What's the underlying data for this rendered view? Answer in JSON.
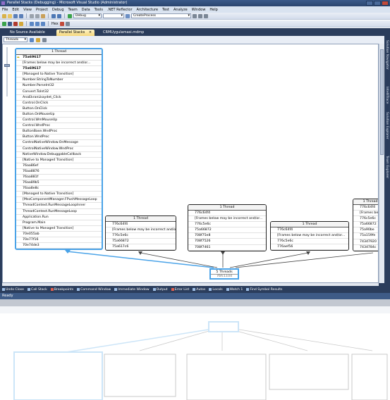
{
  "window": {
    "title": "Parallel Stacks (Debugging) - Microsoft Visual Studio (Administrator)"
  },
  "menu": [
    "File",
    "Edit",
    "View",
    "Project",
    "Debug",
    "Team",
    "Data",
    "Tools",
    ".NET Reflector",
    "Architecture",
    "Test",
    "Analyze",
    "Window",
    "Help"
  ],
  "toolbar": {
    "config_dropdown": "Debug",
    "platform_dropdown": "",
    "find_dropdown": "CreateProcess",
    "hex_label": "Hex"
  },
  "tabs": [
    {
      "label": "No Source Available"
    },
    {
      "label": "Parallel Stacks"
    },
    {
      "label": "CRMUygulamasi.mdmp"
    }
  ],
  "parallel_stacks": {
    "view_dropdown": "Threads",
    "main_stack": {
      "header": "1 Thread",
      "frames": [
        {
          "text": "75a69617",
          "current": true,
          "bold": true
        },
        {
          "text": "[Frames below may be incorrect and/or..."
        },
        {
          "text": "75a69617",
          "bold": true
        },
        {
          "text": "[Managed to Native Transition]"
        },
        {
          "text": "Number.StringToNumber"
        },
        {
          "text": "Number.ParseInt32"
        },
        {
          "text": "Convert.ToInt32"
        },
        {
          "text": "AnaEkranLkaydet_Click"
        },
        {
          "text": "Control.OnClick"
        },
        {
          "text": "Button.OnClick"
        },
        {
          "text": "Button.OnMouseUp"
        },
        {
          "text": "Control.WmMouseUp"
        },
        {
          "text": "Control.WndProc"
        },
        {
          "text": "ButtonBase.WndProc"
        },
        {
          "text": "Button.WndProc"
        },
        {
          "text": "ControlNativeWindow.OnMessage"
        },
        {
          "text": "ControlNativeWindow.WndProc"
        },
        {
          "text": "NativeWindow.DebuggableCallback"
        },
        {
          "text": "[Native to Managed Transition]"
        },
        {
          "text": "76aa86ef"
        },
        {
          "text": "76aa8876"
        },
        {
          "text": "76aa881f"
        },
        {
          "text": "76aa89b5"
        },
        {
          "text": "76aa8e8c"
        },
        {
          "text": "[Managed to Native Transition]"
        },
        {
          "text": "[MsoComponentManager.FPushMessageLoop"
        },
        {
          "text": "ThreadContext.RunMessageLoopInner"
        },
        {
          "text": "ThreadContext.RunMessageLoop"
        },
        {
          "text": "Application.Run"
        },
        {
          "text": "Program.Main"
        },
        {
          "text": "[Native to Managed Transition]"
        },
        {
          "text": "70e055ab"
        },
        {
          "text": "70e77f16"
        },
        {
          "text": "70e74de3"
        }
      ]
    },
    "stacks": [
      {
        "header": "1 Thread",
        "frames": [
          "776c64f4",
          "[Frames below may be incorrect and/or...",
          "776c5e6c",
          "75a66872",
          "75a617c6"
        ]
      },
      {
        "header": "1 Thread",
        "frames": [
          "776c64f4",
          "[Frames below may be incorrect and/or...",
          "776c5e6c",
          "75a66872",
          "708f75e8",
          "708f7526",
          "708f7461"
        ]
      },
      {
        "header": "1 Thread",
        "frames": [
          "776c64f4",
          "[Frames below may be incorrect and/or...",
          "776c5e6c",
          "776aef56"
        ]
      },
      {
        "header": "1 Thread",
        "frames": [
          "776c64f4",
          "[Frames below",
          "776c5e6c",
          "75a66872",
          "75a90be",
          "75a159fe",
          "74347920",
          "7434784c"
        ]
      }
    ],
    "root": {
      "header": "5 Threads",
      "frame": "76fc1104"
    }
  },
  "right_tabs": [
    "Solution Navigator",
    "IntelliTrace",
    "Solution Explorer",
    "Team Explorer"
  ],
  "bottom_tabs": [
    "Undo Close",
    "Call Stack",
    "Breakpoints",
    "Command Window",
    "Immediate Window",
    "Output",
    "Error List",
    "Autos",
    "Locals",
    "Watch 1",
    "Find Symbol Results"
  ],
  "status": {
    "text": "Ready"
  },
  "colors": {
    "chrome": "#2b3d5c",
    "accent_blue": "#4aa3e8",
    "tab_active": "#f5d67a",
    "current_frame_arrow": "#c7a600"
  }
}
